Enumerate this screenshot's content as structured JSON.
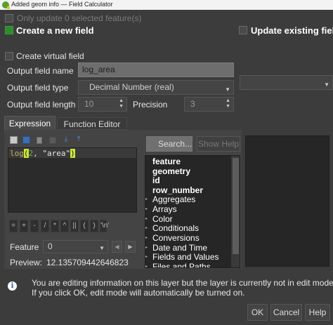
{
  "window": {
    "title": "Added geom info — Field Calculator"
  },
  "top": {
    "only_update_label": "Only update 0 selected feature(s)",
    "create_new_label": "Create a new field",
    "update_existing_label": "Update existing field",
    "create_virtual_label": "Create virtual field"
  },
  "form": {
    "output_name_label": "Output field name",
    "output_name_value": "log_area",
    "output_type_label": "Output field type",
    "output_type_value": "Decimal Number (real)",
    "output_length_label": "Output field length",
    "output_length_value": "10",
    "precision_label": "Precision",
    "precision_value": "3"
  },
  "tabs": {
    "expression": "Expression",
    "function_editor": "Function Editor"
  },
  "expression": {
    "parts": [
      "log",
      "(",
      "2",
      ", ",
      "\"area\"",
      ")"
    ],
    "operators": [
      "=",
      "+",
      "-",
      "/",
      "*",
      "^",
      "||",
      "(",
      ")",
      "'\\n'"
    ]
  },
  "feature": {
    "label": "Feature",
    "value": "0"
  },
  "preview": {
    "label": "Preview:",
    "value": "12.135709442646823"
  },
  "search": {
    "placeholder": "Search...",
    "show_help_label": "Show Help"
  },
  "function_list": [
    {
      "label": "feature",
      "bold": true,
      "expandable": false
    },
    {
      "label": "geometry",
      "bold": true,
      "expandable": false
    },
    {
      "label": "id",
      "bold": true,
      "expandable": false
    },
    {
      "label": "row_number",
      "bold": true,
      "expandable": false
    },
    {
      "label": "Aggregates",
      "bold": false,
      "expandable": true
    },
    {
      "label": "Arrays",
      "bold": false,
      "expandable": true
    },
    {
      "label": "Color",
      "bold": false,
      "expandable": true
    },
    {
      "label": "Conditionals",
      "bold": false,
      "expandable": true
    },
    {
      "label": "Conversions",
      "bold": false,
      "expandable": true
    },
    {
      "label": "Date and Time",
      "bold": false,
      "expandable": true
    },
    {
      "label": "Fields and Values",
      "bold": false,
      "expandable": true
    },
    {
      "label": "Files and Paths",
      "bold": false,
      "expandable": true
    }
  ],
  "info": {
    "message_line1": "You are editing information on this layer but the layer is currently not in edit mode.",
    "message_line2": "If you click OK, edit mode will automatically be turned on."
  },
  "buttons": {
    "ok": "OK",
    "cancel": "Cancel",
    "help": "Help"
  },
  "colors": {
    "background": "#3c3c3c",
    "accent_green": "#2e8b2e",
    "code_function": "#c9b35a",
    "code_number": "#6ab04c",
    "code_string": "#e6e6e6",
    "paren_highlight": "#c7e93a"
  }
}
